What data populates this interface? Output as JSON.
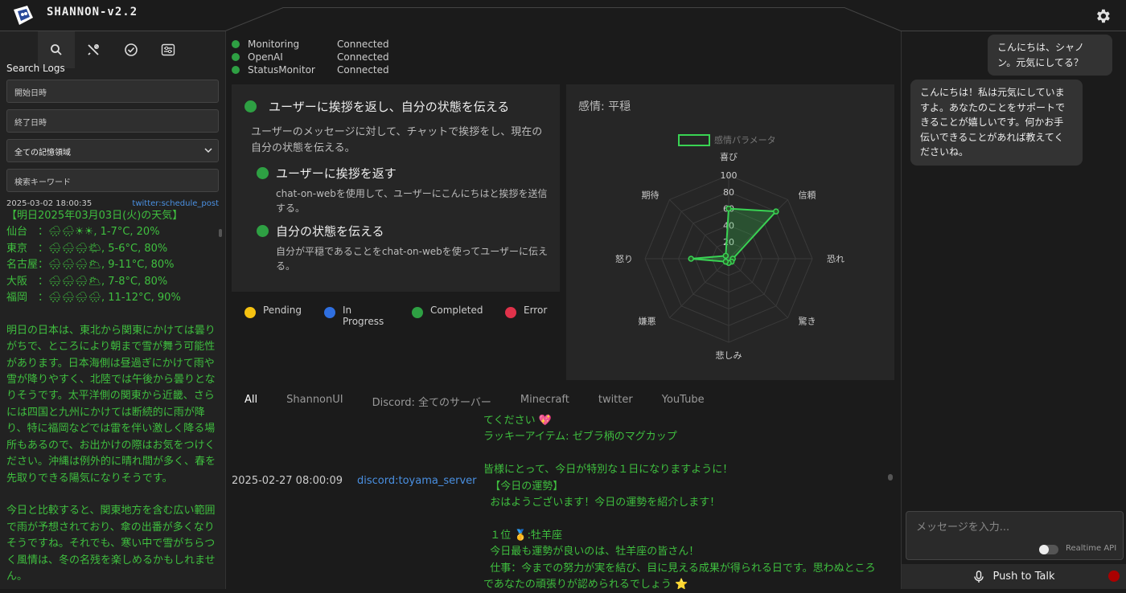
{
  "app": {
    "title": "SHANNON-v2.2"
  },
  "sidebar": {
    "tabs": [
      {
        "icon": "search-icon"
      },
      {
        "icon": "tools-icon"
      },
      {
        "icon": "check-circle-icon"
      },
      {
        "icon": "sliders-icon"
      }
    ],
    "title": "Search Logs",
    "start_placeholder": "開始日時",
    "end_placeholder": "終了日時",
    "memory_select": "全ての記憶領域",
    "keyword_placeholder": "検索キーワード",
    "log": {
      "timestamp": "2025-03-02 18:00:35",
      "source": "twitter:schedule_post",
      "content": "【明日2025年03月03日(火)の天気】\n仙台　：🌧🌧☀☀, 1-7°C, 20%\n東京　：🌨🌨🌨🌤, 5-6°C, 80%\n名古屋：🌨🌨🌨🌥, 9-11°C, 80%\n大阪　：🌨🌨🌨🌥, 7-8°C, 80%\n福岡　：🌨🌨🌧🌧, 11-12°C, 90%\n\n明日の日本は、東北から関東にかけては曇りがちで、ところにより朝まで雪が舞う可能性があります。日本海側は昼過ぎにかけて雨や雪が降りやすく、北陸では午後から曇りとなりそうです。太平洋側の関東から近畿、さらには四国と九州にかけては断続的に雨が降り、特に福岡などでは雷を伴い激しく降る場所もあるので、お出かけの際はお気をつけください。沖縄は例外的に晴れ間が多く、春を先取りできる陽気になりそうです。\n\n今日と比較すると、関東地方を含む広い範囲で雨が予想されており、傘の出番が多くなりそうですね。それでも、寒い中で雪がちらつく風情は、冬の名残を楽しめるかもしれません。"
    }
  },
  "status": [
    {
      "name": "Monitoring",
      "state": "Connected"
    },
    {
      "name": "OpenAI",
      "state": "Connected"
    },
    {
      "name": "StatusMonitor",
      "state": "Connected"
    }
  ],
  "task": {
    "title": "ユーザーに挨拶を返し、自分の状態を伝える",
    "description": "ユーザーのメッセージに対して、チャットで挨拶をし、現在の自分の状態を伝える。",
    "subtasks": [
      {
        "title": "ユーザーに挨拶を返す",
        "desc": "chat-on-webを使用して、ユーザーにこんにちはと挨拶を送信する。"
      },
      {
        "title": "自分の状態を伝える",
        "desc": "自分が平穏であることをchat-on-webを使ってユーザーに伝える。"
      }
    ]
  },
  "legend": [
    {
      "label": "Pending",
      "color": "#f5c211"
    },
    {
      "label": "In Progress",
      "color": "#2f6fe0"
    },
    {
      "label": "Completed",
      "color": "#2ea043"
    },
    {
      "label": "Error",
      "color": "#e0324a"
    }
  ],
  "emotion": {
    "title": "感情: 平穏",
    "legend_label": "感情パラメータ"
  },
  "chart_data": {
    "type": "radar",
    "title": "感情: 平穏",
    "series": [
      {
        "name": "感情パラメータ",
        "color": "#39d353",
        "values": [
          60,
          80,
          5,
          5,
          5,
          5,
          45,
          5
        ]
      }
    ],
    "categories": [
      "喜び",
      "信頼",
      "恐れ",
      "驚き",
      "悲しみ",
      "嫌悪",
      "怒り",
      "期待"
    ],
    "ticks": [
      "20",
      "40",
      "60",
      "80",
      "100"
    ],
    "range": [
      0,
      100
    ]
  },
  "feed": {
    "tabs": [
      "All",
      "ShannonUI",
      "Discord: 全てのサーバー",
      "Minecraft",
      "twitter",
      "YouTube"
    ],
    "active_tab": "All",
    "timestamp": "2025-02-27 08:00:09",
    "source": "discord:toyama_server",
    "message": "てください 💖\nラッキーアイテム: ゼブラ柄のマグカップ\n\n皆様にとって、今日が特別な１日になりますように！\n  【今日の運勢】\n  おはようございます！今日の運勢を紹介します！\n\n  １位 🥇:牡羊座\n  今日最も運勢が良いのは、牡羊座の皆さん！\n  仕事：今までの努力が実を結び、目に見える成果が得られる日です。思わぬところであなたの頑張りが認められるでしょう ⭐"
  },
  "chat": {
    "messages": [
      {
        "role": "user",
        "text": "こんにちは、シャノン。元気にしてる？"
      },
      {
        "role": "assistant",
        "text": "こんにちは！私は元気にしていますよ。あなたのことをサポートできることが嬉しいです。何かお手伝いできることがあれば教えてくださいね。"
      }
    ],
    "input_placeholder": "メッセージを入力...",
    "realtime_label": "Realtime API",
    "push_to_talk": "Push to Talk"
  }
}
